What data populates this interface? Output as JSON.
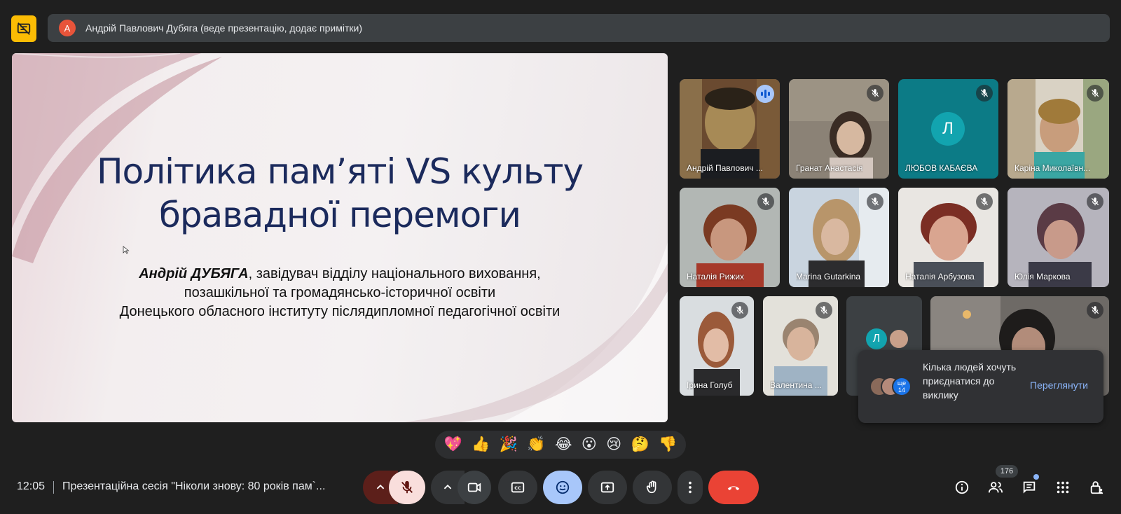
{
  "presenter_bar": {
    "avatar_letter": "А",
    "text": "Андрій Павлович Дубяга (веде презентацію, додає примітки)"
  },
  "slide": {
    "title_line1": "Політика пам’яті VS культу",
    "title_line2": "бравадної перемоги",
    "author_name": "Андрій ДУБЯГА",
    "author_line1_rest": ", завідувач відділу національного виховання,",
    "author_line2": "позашкільної та громадянсько-історичної освіти",
    "author_line3": "Донецького обласного інституту післядипломної педагогічної освіти"
  },
  "participants": [
    {
      "name": "Андрій Павлович ...",
      "speaking": true
    },
    {
      "name": "Гранат Анастасія",
      "muted": true
    },
    {
      "name": "ЛЮБОВ КАБАЄВА",
      "avatar_letter": "Л",
      "muted": true
    },
    {
      "name": "Каріна Миколаївн...",
      "muted": true
    },
    {
      "name": "Наталія Рижих",
      "muted": true
    },
    {
      "name": "Marina Gutarkina",
      "muted": true
    },
    {
      "name": "Наталія Арбузова",
      "muted": true
    },
    {
      "name": "Юлія Маркова",
      "muted": true
    },
    {
      "name": "Ірина Голуб",
      "muted": true
    },
    {
      "name": "Валентина ...",
      "muted": true
    },
    {
      "name": "",
      "avatar_letter": "Л"
    },
    {
      "name": "",
      "muted": true
    }
  ],
  "toast": {
    "text": "Кілька людей хочуть приєднатися до виклику",
    "more_label": "ще 14",
    "link": "Переглянути"
  },
  "reactions": [
    "💖",
    "👍",
    "🎉",
    "👏",
    "😂",
    "😮",
    "😢",
    "🤔",
    "👎"
  ],
  "bottom": {
    "time": "12:05",
    "meeting_name": "Презентаційна сесія \"Ніколи знову: 80 років пам`...",
    "participants_count": "176"
  },
  "colors": {
    "accent": "#a8c7fa",
    "end_call": "#ea4335",
    "mic_off": "#f9dedc",
    "presenting": "#fbbc04"
  }
}
